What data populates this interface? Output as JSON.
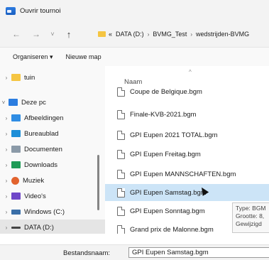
{
  "window": {
    "title": "Ouvrir tournoi"
  },
  "nav": {
    "back": "←",
    "forward": "→",
    "recent": "˅",
    "up": "↑"
  },
  "address": {
    "overflow": "«",
    "crumbs": [
      "DATA (D:)",
      "BVMG_Test",
      "wedstrijden-BVMG"
    ]
  },
  "toolbar": {
    "organize": "Organiseren ▾",
    "new_folder": "Nieuwe map"
  },
  "sidebar": {
    "items": [
      {
        "label": "tuin",
        "icon": "folder-icon",
        "color": "#f5c542"
      },
      {
        "label": "Deze pc",
        "icon": "computer-icon",
        "color": "#2b7de0"
      },
      {
        "label": "Afbeeldingen",
        "icon": "pictures-icon",
        "color": "#2f8de4"
      },
      {
        "label": "Bureaublad",
        "icon": "desktop-icon",
        "color": "#1e8fd8"
      },
      {
        "label": "Documenten",
        "icon": "documents-icon",
        "color": "#8b9aa8"
      },
      {
        "label": "Downloads",
        "icon": "downloads-icon",
        "color": "#1f9b57"
      },
      {
        "label": "Muziek",
        "icon": "music-icon",
        "color": "#e2632e"
      },
      {
        "label": "Video's",
        "icon": "videos-icon",
        "color": "#6f47c8"
      },
      {
        "label": "Windows (C:)",
        "icon": "drive-c-icon",
        "color": "#3a6fa8"
      },
      {
        "label": "DATA (D:)",
        "icon": "drive-d-icon",
        "color": "#444444"
      }
    ]
  },
  "filelist": {
    "column_name": "Naam",
    "files": [
      "Coupe de Belgique.bgm",
      "Finale-KVB-2021.bgm",
      "GPI Eupen 2021 TOTAL.bgm",
      "GPI Eupen Freitag.bgm",
      "GPI Eupen MANNSCHAFTEN.bgm",
      "GPI Eupen Samstag.bgm",
      "GPI Eupen Sonntag.bgm",
      "Grand prix de Malonne.bgm"
    ],
    "selected_index": 5
  },
  "tooltip": {
    "lines": [
      "Type: BGM",
      "Grootte: 8,",
      "Gewijzigd"
    ]
  },
  "footer": {
    "filename_label": "Bestandsnaam:",
    "filename_value": "GPI Eupen Samstag.bgm"
  },
  "colors": {
    "selection": "#cce4f7",
    "folder": "#f5c542"
  }
}
